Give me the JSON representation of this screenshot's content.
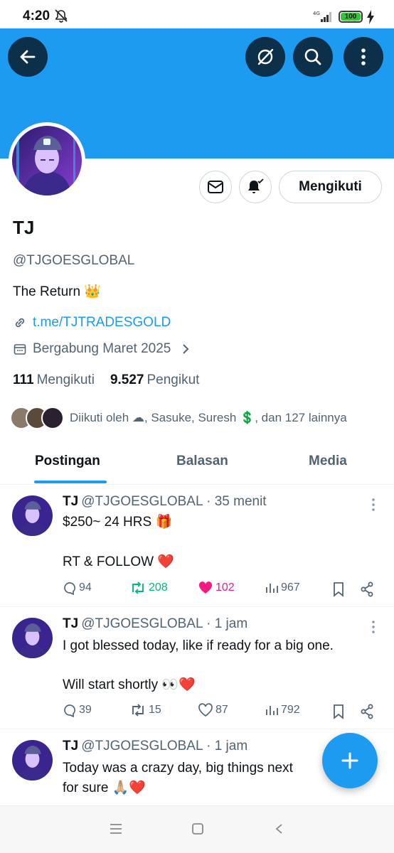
{
  "status_bar": {
    "time": "4:20",
    "network": "4G",
    "battery": "100",
    "icons": [
      "mute-icon",
      "signal-icon",
      "battery-icon",
      "charging-icon"
    ]
  },
  "header": {
    "icons": [
      "back-arrow-icon",
      "grok-icon",
      "search-icon",
      "more-vertical-icon"
    ]
  },
  "profile": {
    "name": "TJ",
    "handle": "@TJGOESGLOBAL",
    "bio": "The Return 👑",
    "link": "t.me/TJTRADESGOLD",
    "joined": "Bergabung Maret 2025",
    "following_count": "111",
    "following_label": "Mengikuti",
    "followers_count": "9.527",
    "followers_label": "Pengikut",
    "followed_by": "Diikuti oleh ☁︎, Sasuke, Suresh 💲, dan 127 lainnya",
    "follow_button": "Mengikuti"
  },
  "tabs": [
    {
      "label": "Postingan",
      "active": true
    },
    {
      "label": "Balasan",
      "active": false
    },
    {
      "label": "Media",
      "active": false
    }
  ],
  "posts": [
    {
      "name": "TJ",
      "handle": "@TJGOESGLOBAL",
      "time": "· 35 menit",
      "lines": [
        "$250~ 24 HRS 🎁",
        "",
        "RT & FOLLOW ❤️"
      ],
      "replies": "94",
      "reposts": "208",
      "likes": "102",
      "views": "967",
      "reposted": true,
      "liked": true
    },
    {
      "name": "TJ",
      "handle": "@TJGOESGLOBAL",
      "time": "· 1 jam",
      "lines": [
        "I got blessed today, like if ready for a big one.",
        "",
        "Will start shortly 👀❤️"
      ],
      "replies": "39",
      "reposts": "15",
      "likes": "87",
      "views": "792",
      "reposted": false,
      "liked": false
    },
    {
      "name": "TJ",
      "handle": "@TJGOESGLOBAL",
      "time": "· 1 jam",
      "lines": [
        "Today was a crazy day, big things next",
        "for sure 🙏🏼❤️"
      ]
    }
  ],
  "colors": {
    "accent": "#1d9bf0",
    "banner": "#1d9bf0",
    "repost_active": "#00ba7c",
    "like_active": "#f91880",
    "muted_text": "#536471"
  }
}
